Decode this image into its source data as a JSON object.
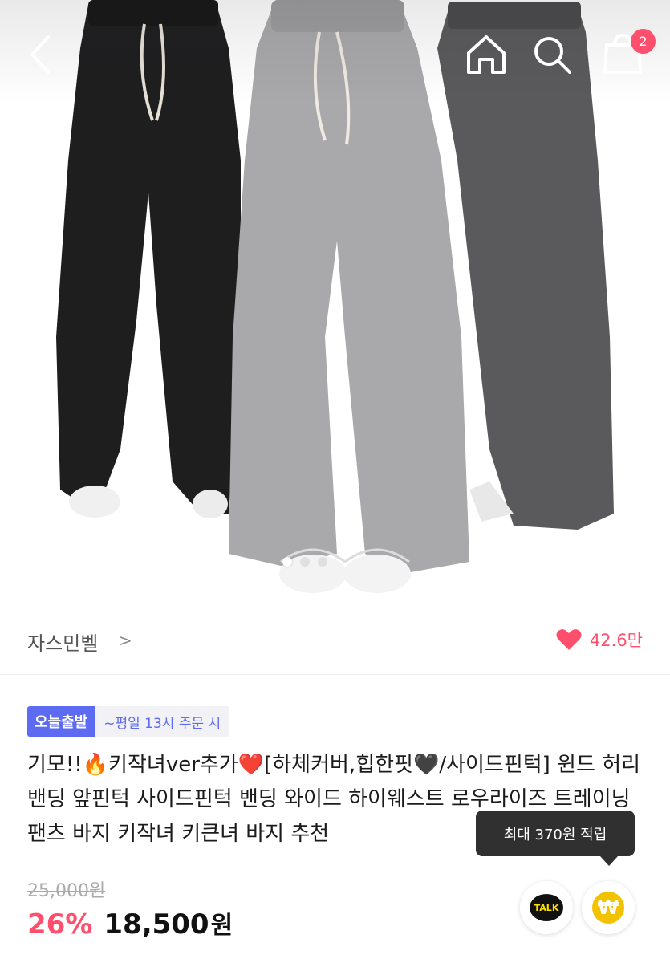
{
  "header": {
    "cart_badge": "2"
  },
  "gallery": {
    "total_slides": 3,
    "active_index": 0
  },
  "brand": {
    "name": "자스민벨",
    "chevron": ">",
    "likes": "42.6만"
  },
  "badges": {
    "shipping": "오늘출발",
    "shipping_note": "~평일 13시 주문 시"
  },
  "product": {
    "title": "기모!!🔥키작녀ver추가❤️[하체커버,힙한핏🖤/사이드핀턱] 윈드 허리 밴딩 앞핀턱 사이드핀턱 밴딩 와이드 하이웨스트 로우라이즈 트레이닝 팬츠 바지 키작녀 키큰녀 바지 추천",
    "original_price": "25,000원",
    "discount": "26%",
    "price": "18,500",
    "price_unit": "원"
  },
  "tooltip": {
    "text": "최대 370원 적립"
  },
  "actions": {
    "talk_label": "TALK",
    "point_symbol": "₩"
  },
  "colors": {
    "accent": "#ff4f6d",
    "shipping_badge": "#5c6bf2",
    "talk_yellow": "#ffe000",
    "coin": "#f2c200"
  }
}
